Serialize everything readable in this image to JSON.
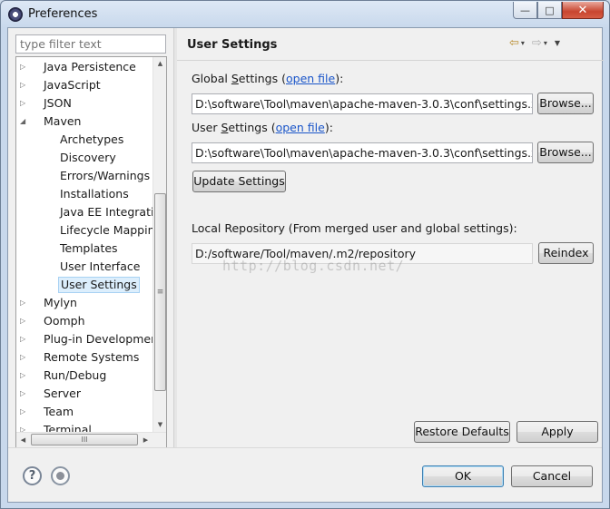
{
  "window": {
    "title": "Preferences",
    "controls": {
      "minimize": "—",
      "maximize": "□",
      "close": "✕"
    }
  },
  "sidebar": {
    "filter_placeholder": "type filter text",
    "items": [
      {
        "label": "Java Persistence",
        "level": 0,
        "state": "collapsed"
      },
      {
        "label": "JavaScript",
        "level": 0,
        "state": "collapsed"
      },
      {
        "label": "JSON",
        "level": 0,
        "state": "collapsed"
      },
      {
        "label": "Maven",
        "level": 0,
        "state": "expanded"
      },
      {
        "label": "Archetypes",
        "level": 1
      },
      {
        "label": "Discovery",
        "level": 1
      },
      {
        "label": "Errors/Warnings",
        "level": 1
      },
      {
        "label": "Installations",
        "level": 1
      },
      {
        "label": "Java EE Integration",
        "level": 1
      },
      {
        "label": "Lifecycle Mappings",
        "level": 1
      },
      {
        "label": "Templates",
        "level": 1
      },
      {
        "label": "User Interface",
        "level": 1
      },
      {
        "label": "User Settings",
        "level": 1,
        "selected": true
      },
      {
        "label": "Mylyn",
        "level": 0,
        "state": "collapsed"
      },
      {
        "label": "Oomph",
        "level": 0,
        "state": "collapsed"
      },
      {
        "label": "Plug-in Development",
        "level": 0,
        "state": "collapsed"
      },
      {
        "label": "Remote Systems",
        "level": 0,
        "state": "collapsed"
      },
      {
        "label": "Run/Debug",
        "level": 0,
        "state": "collapsed"
      },
      {
        "label": "Server",
        "level": 0,
        "state": "collapsed"
      },
      {
        "label": "Team",
        "level": 0,
        "state": "collapsed"
      },
      {
        "label": "Terminal",
        "level": 0,
        "state": "collapsed"
      }
    ],
    "scroll_glyphs": {
      "up": "▲",
      "down": "▼",
      "left": "◀",
      "right": "▶",
      "vgrip": "≡",
      "hgrip": "III"
    }
  },
  "page": {
    "title": "User Settings",
    "nav": {
      "back": "⇦",
      "forward": "⇨",
      "dropdown": "▾",
      "menu": "▼"
    },
    "global_settings": {
      "label_prefix": "Global ",
      "label_mnemonic": "S",
      "label_rest": "ettings (",
      "link": "open file",
      "label_suffix": "):",
      "value": "D:\\software\\Tool\\maven\\apache-maven-3.0.3\\conf\\settings.xml",
      "browse": "Browse..."
    },
    "user_settings": {
      "label_prefix": "User ",
      "label_mnemonic": "S",
      "label_rest": "ettings (",
      "link": "open file",
      "label_suffix": "):",
      "value": "D:\\software\\Tool\\maven\\apache-maven-3.0.3\\conf\\settings.xml",
      "browse": "Browse..."
    },
    "update_settings": "Update Settings",
    "local_repository": {
      "label": "Local Repository (From merged user and global settings):",
      "value": "D:/software/Tool/maven/.m2/repository",
      "reindex": "Reindex"
    },
    "watermark": "http://blog.csdn.net/",
    "restore_defaults": "Restore Defaults",
    "apply": "Apply"
  },
  "footer": {
    "help_icon": "?",
    "ok": "OK",
    "cancel": "Cancel"
  }
}
